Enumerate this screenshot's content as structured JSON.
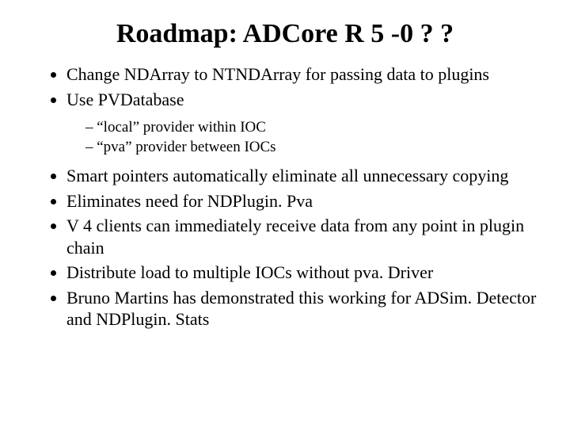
{
  "title": "Roadmap: ADCore R 5 -0 ? ?",
  "bullets1": {
    "b0": "Change NDArray to NTNDArray for passing data to plugins",
    "b1": "Use PVDatabase"
  },
  "sub1": {
    "s0": "“local” provider within IOC",
    "s1": "“pva” provider between IOCs"
  },
  "bullets2": {
    "b0": "Smart pointers automatically eliminate all unnecessary copying",
    "b1": "Eliminates need for NDPlugin. Pva",
    "b2": "V 4 clients can immediately receive data from any point in plugin chain",
    "b3": "Distribute load to multiple IOCs without pva. Driver",
    "b4": "Bruno Martins has demonstrated this working for ADSim. Detector and NDPlugin. Stats"
  }
}
